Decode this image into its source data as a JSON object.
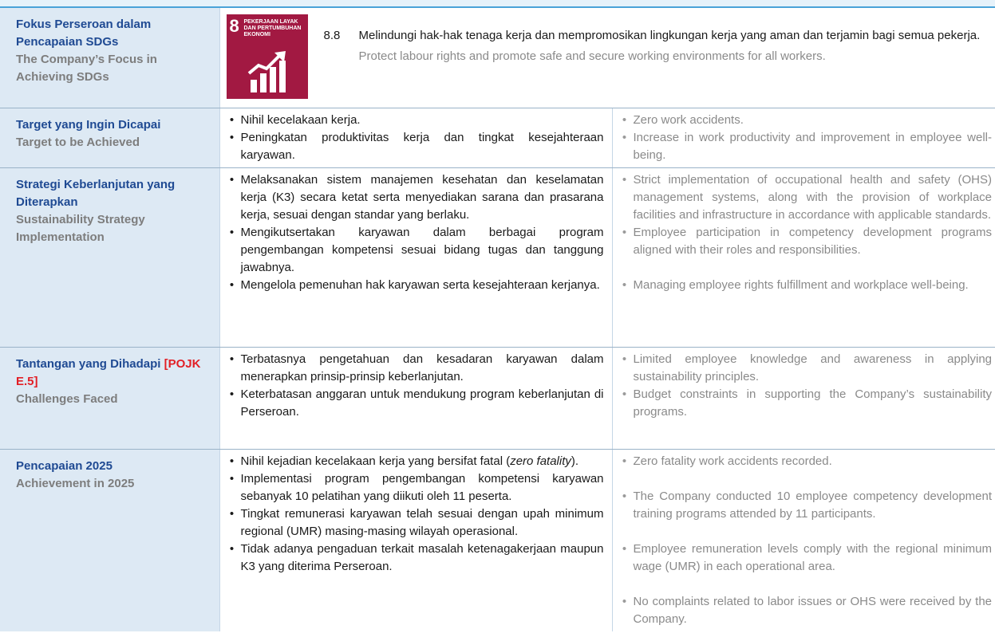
{
  "focus": {
    "label_id": "Fokus Perseroan dalam Pencapaian SDGs",
    "label_en": "The Company’s Focus in Achieving SDGs",
    "sdg_number": "8",
    "sdg_title": "PEKERJAAN LAYAK DAN PERTUMBUHAN EKONOMI",
    "sdg_color": "#a21942",
    "target_number": "8.8",
    "target_id": "Melindungi hak-hak tenaga kerja dan mempromosikan lingkungan kerja yang aman dan terjamin bagi semua pekerja.",
    "target_en": "Protect labour rights and promote safe and secure working environments for all workers."
  },
  "target": {
    "label_id": "Target yang Ingin Dicapai",
    "label_en": "Target to be Achieved",
    "items_id": [
      "Nihil kecelakaan kerja.",
      "Peningkatan produktivitas kerja dan tingkat kesejahteraan karyawan."
    ],
    "items_en": [
      "Zero work accidents.",
      "Increase in work productivity and improvement in employee well-being."
    ]
  },
  "strategy": {
    "label_id": "Strategi Keberlanjutan yang Diterapkan",
    "label_en": "Sustainability Strategy Implementation",
    "items_id": [
      "Melaksanakan sistem manajemen kesehatan dan keselamatan kerja (K3) secara ketat serta menyediakan sarana dan prasarana kerja, sesuai dengan standar yang berlaku.",
      "Mengikutsertakan karyawan dalam berbagai program pengembangan kompetensi sesuai bidang tugas dan tanggung jawabnya.",
      "Mengelola pemenuhan hak karyawan serta kesejahteraan kerjanya."
    ],
    "items_en": [
      "Strict implementation of occupational health and safety (OHS) management systems, along with the provision of workplace facilities and infrastructure in accordance with applicable standards.",
      "Employee participation in competency development programs aligned with their roles and responsibilities.",
      "Managing employee rights fulfillment and workplace well-being."
    ]
  },
  "challenges": {
    "label_id": "Tantangan yang Dihadapi",
    "label_ref": "[POJK E.5]",
    "label_en": "Challenges Faced",
    "items_id": [
      "Terbatasnya pengetahuan dan kesadaran karyawan dalam menerapkan prinsip-prinsip keberlanjutan.",
      "Keterbatasan anggaran untuk mendukung program keberlanjutan di Perseroan."
    ],
    "items_en": [
      "Limited employee knowledge and awareness in applying sustainability principles.",
      "Budget constraints in supporting the Company’s sustainability programs."
    ]
  },
  "achievement": {
    "label_id": "Pencapaian 2025",
    "label_en": "Achievement in 2025",
    "item1_id_prefix": "Nihil kejadian kecelakaan kerja yang bersifat fatal (",
    "item1_id_italic": "zero fatality",
    "item1_id_suffix": ").",
    "items_id": [
      "Implementasi program pengembangan kompetensi karyawan sebanyak 10 pelatihan yang diikuti oleh 11 peserta.",
      "Tingkat remunerasi karyawan telah sesuai dengan upah minimum regional (UMR) masing-masing wilayah operasional.",
      "Tidak adanya pengaduan terkait masalah ketenagakerjaan maupun K3 yang diterima Perseroan."
    ],
    "items_en": [
      "Zero fatality work accidents recorded.",
      "The Company conducted 10 employee competency development training programs attended by 11 participants.",
      "Employee remuneration levels comply with the regional minimum wage (UMR) in each operational area.",
      "No complaints related to labor issues or OHS were received by the Company."
    ]
  },
  "bullet": "•"
}
